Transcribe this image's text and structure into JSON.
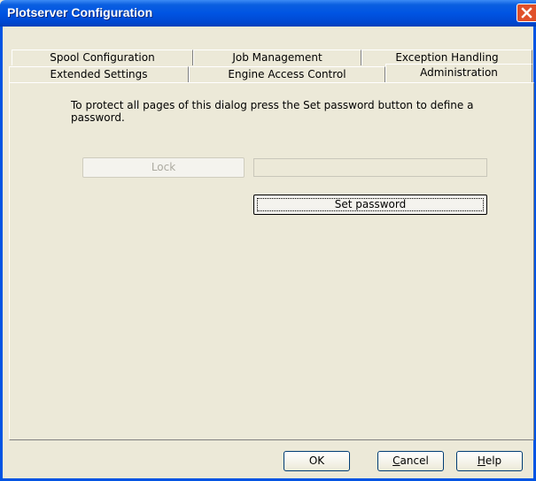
{
  "window": {
    "title": "Plotserver Configuration"
  },
  "tabs_back": [
    "Spool Configuration",
    "Job Management",
    "Exception Handling"
  ],
  "tabs_front": [
    "Extended Settings",
    "Engine Access Control",
    "Administration"
  ],
  "active_tab": "Administration",
  "panel": {
    "info_text": "To protect all pages of this dialog press the Set password button to define a password.",
    "lock_label": "Lock",
    "password_value": "",
    "set_password_label": "Set password"
  },
  "footer": {
    "ok_label": "OK",
    "cancel_label": "Cancel",
    "help_label": "Help"
  },
  "colors": {
    "titlebar": "#0054e3",
    "close": "#e0502a",
    "dialog_bg": "#ece9d8"
  }
}
